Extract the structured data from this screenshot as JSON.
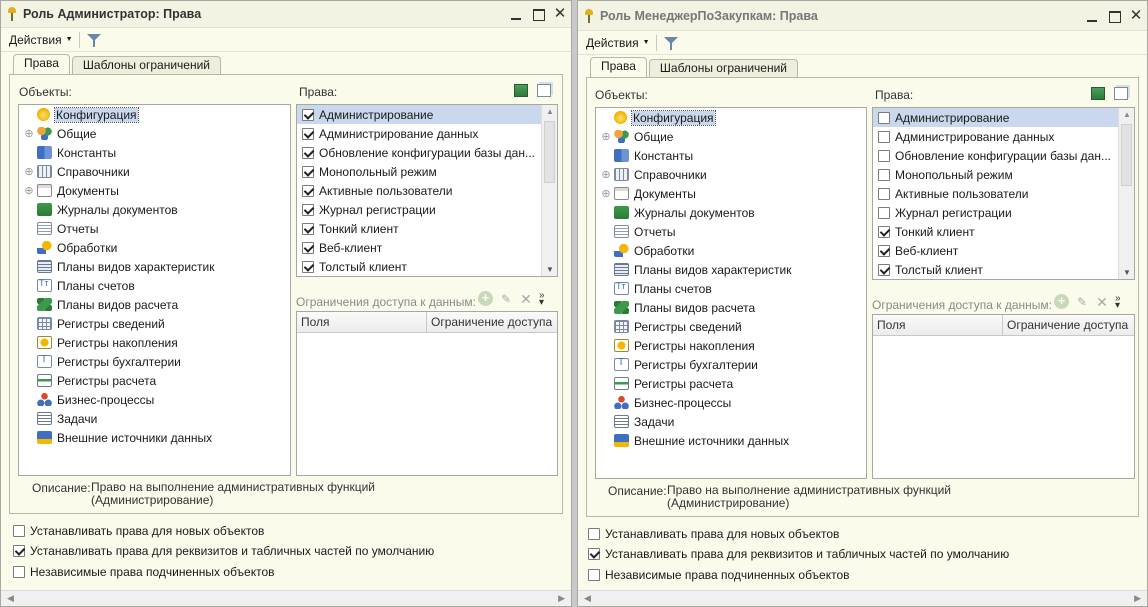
{
  "windows": [
    {
      "title": "Роль Администратор: Права",
      "actions_label": "Действия",
      "tabs": [
        "Права",
        "Шаблоны ограничений"
      ],
      "objects_label": "Объекты:",
      "rights_label": "Права:",
      "tree": [
        {
          "label": "Конфигурация",
          "icon": "config-icon",
          "expandable": false,
          "selected": true
        },
        {
          "label": "Общие",
          "icon": "common-icon",
          "expandable": true
        },
        {
          "label": "Константы",
          "icon": "constants-icon",
          "expandable": false
        },
        {
          "label": "Справочники",
          "icon": "catalogs-icon",
          "expandable": true
        },
        {
          "label": "Документы",
          "icon": "documents-icon",
          "expandable": true
        },
        {
          "label": "Журналы документов",
          "icon": "journals-icon",
          "expandable": false
        },
        {
          "label": "Отчеты",
          "icon": "reports-icon",
          "expandable": false
        },
        {
          "label": "Обработки",
          "icon": "processing-icon",
          "expandable": false
        },
        {
          "label": "Планы видов характеристик",
          "icon": "chartypes-icon",
          "expandable": false
        },
        {
          "label": "Планы счетов",
          "icon": "accounts-icon",
          "expandable": false
        },
        {
          "label": "Планы видов расчета",
          "icon": "calctypes-icon",
          "expandable": false
        },
        {
          "label": "Регистры сведений",
          "icon": "inforeg-icon",
          "expandable": false
        },
        {
          "label": "Регистры накопления",
          "icon": "accumreg-icon",
          "expandable": false
        },
        {
          "label": "Регистры бухгалтерии",
          "icon": "accountreg-icon",
          "expandable": false
        },
        {
          "label": "Регистры расчета",
          "icon": "calcreg-icon",
          "expandable": false
        },
        {
          "label": "Бизнес-процессы",
          "icon": "bizproc-icon",
          "expandable": false
        },
        {
          "label": "Задачи",
          "icon": "tasks-icon",
          "expandable": false
        },
        {
          "label": "Внешние источники данных",
          "icon": "external-icon",
          "expandable": false
        }
      ],
      "rights": [
        {
          "label": "Администрирование",
          "checked": true,
          "selected": true
        },
        {
          "label": "Администрирование данных",
          "checked": true
        },
        {
          "label": "Обновление конфигурации базы дан...",
          "checked": true
        },
        {
          "label": "Монопольный режим",
          "checked": true
        },
        {
          "label": "Активные пользователи",
          "checked": true
        },
        {
          "label": "Журнал регистрации",
          "checked": true
        },
        {
          "label": "Тонкий клиент",
          "checked": true
        },
        {
          "label": "Веб-клиент",
          "checked": true
        },
        {
          "label": "Толстый клиент",
          "checked": true
        }
      ],
      "restrictions_label": "Ограничения доступа к данным:",
      "grid_columns": [
        "Поля",
        "Ограничение доступа"
      ],
      "description_label": "Описание:",
      "description_line1": "Право на выполнение административных функций",
      "description_line2": "(Администрирование)",
      "options": [
        {
          "label": "Устанавливать права для новых объектов",
          "checked": false
        },
        {
          "label": "Устанавливать права для реквизитов и табличных частей по умолчанию",
          "checked": true
        },
        {
          "label": "Независимые права подчиненных объектов",
          "checked": false
        }
      ]
    },
    {
      "title": "Роль МенеджерПоЗакупкам: Права",
      "actions_label": "Действия",
      "tabs": [
        "Права",
        "Шаблоны ограничений"
      ],
      "objects_label": "Объекты:",
      "rights_label": "Права:",
      "tree": [
        {
          "label": "Конфигурация",
          "icon": "config-icon",
          "expandable": false,
          "selected": true
        },
        {
          "label": "Общие",
          "icon": "common-icon",
          "expandable": true
        },
        {
          "label": "Константы",
          "icon": "constants-icon",
          "expandable": false
        },
        {
          "label": "Справочники",
          "icon": "catalogs-icon",
          "expandable": true
        },
        {
          "label": "Документы",
          "icon": "documents-icon",
          "expandable": true
        },
        {
          "label": "Журналы документов",
          "icon": "journals-icon",
          "expandable": false
        },
        {
          "label": "Отчеты",
          "icon": "reports-icon",
          "expandable": false
        },
        {
          "label": "Обработки",
          "icon": "processing-icon",
          "expandable": false
        },
        {
          "label": "Планы видов характеристик",
          "icon": "chartypes-icon",
          "expandable": false
        },
        {
          "label": "Планы счетов",
          "icon": "accounts-icon",
          "expandable": false
        },
        {
          "label": "Планы видов расчета",
          "icon": "calctypes-icon",
          "expandable": false
        },
        {
          "label": "Регистры сведений",
          "icon": "inforeg-icon",
          "expandable": false
        },
        {
          "label": "Регистры накопления",
          "icon": "accumreg-icon",
          "expandable": false
        },
        {
          "label": "Регистры бухгалтерии",
          "icon": "accountreg-icon",
          "expandable": false
        },
        {
          "label": "Регистры расчета",
          "icon": "calcreg-icon",
          "expandable": false
        },
        {
          "label": "Бизнес-процессы",
          "icon": "bizproc-icon",
          "expandable": false
        },
        {
          "label": "Задачи",
          "icon": "tasks-icon",
          "expandable": false
        },
        {
          "label": "Внешние источники данных",
          "icon": "external-icon",
          "expandable": false
        }
      ],
      "rights": [
        {
          "label": "Администрирование",
          "checked": false,
          "selected": true
        },
        {
          "label": "Администрирование данных",
          "checked": false
        },
        {
          "label": "Обновление конфигурации базы дан...",
          "checked": false
        },
        {
          "label": "Монопольный режим",
          "checked": false
        },
        {
          "label": "Активные пользователи",
          "checked": false
        },
        {
          "label": "Журнал регистрации",
          "checked": false
        },
        {
          "label": "Тонкий клиент",
          "checked": true
        },
        {
          "label": "Веб-клиент",
          "checked": true
        },
        {
          "label": "Толстый клиент",
          "checked": true
        }
      ],
      "restrictions_label": "Ограничения доступа к данным:",
      "grid_columns": [
        "Поля",
        "Ограничение доступа"
      ],
      "description_label": "Описание:",
      "description_line1": "Право на выполнение административных функций",
      "description_line2": "(Администрирование)",
      "options": [
        {
          "label": "Устанавливать права для новых объектов",
          "checked": false
        },
        {
          "label": "Устанавливать права для реквизитов и табличных частей по умолчанию",
          "checked": true
        },
        {
          "label": "Независимые права подчиненных объектов",
          "checked": false
        }
      ]
    }
  ]
}
